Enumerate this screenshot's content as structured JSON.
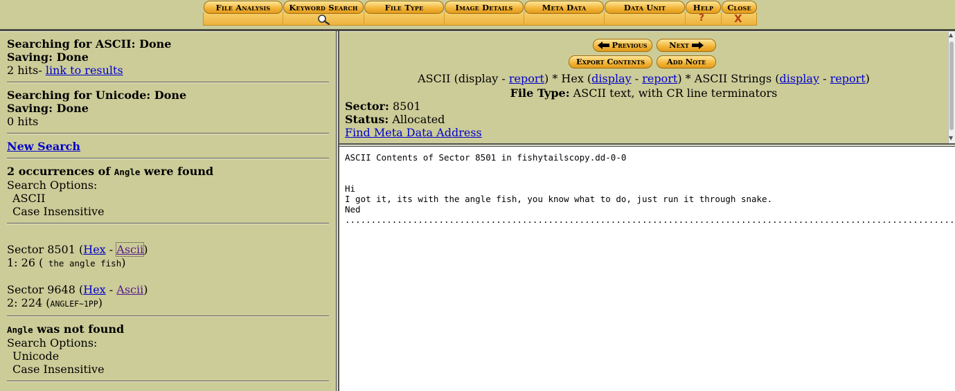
{
  "toolbar": {
    "file_analysis": "File Analysis",
    "keyword_search": "Keyword Search",
    "file_type": "File Type",
    "image_details": "Image Details",
    "meta_data": "Meta Data",
    "data_unit": "Data Unit",
    "help": "Help",
    "help_glyph": "?",
    "close": "Close",
    "close_glyph": "X"
  },
  "left": {
    "ascii_search": {
      "label": "Searching for ASCII",
      "status": ": Done"
    },
    "ascii_saving": {
      "label": "Saving",
      "status": ": Done"
    },
    "ascii_hits": "2 hits- ",
    "results_link": "link to results",
    "unicode_search": {
      "label": "Searching for Unicode",
      "status": ": Done"
    },
    "unicode_saving": {
      "label": "Saving",
      "status": ": Done"
    },
    "unicode_hits": "0 hits",
    "new_search": "New Search",
    "found": {
      "prefix": "2 occurrences of ",
      "keyword": "Angle",
      "suffix": " were found"
    },
    "found_options_label": "Search Options:",
    "found_options": [
      "ASCII",
      "Case Insensitive"
    ],
    "hits": [
      {
        "sector": "Sector 8501 (",
        "hex": "Hex",
        "sep": " - ",
        "ascii": "Ascii",
        "close": ")",
        "offset": "1: 26 (",
        "context": " the angle fish",
        "end": ")"
      },
      {
        "sector": "Sector 9648 (",
        "hex": "Hex",
        "sep": " - ",
        "ascii": "Ascii",
        "close": ")",
        "offset": "2: 224 (",
        "context": "ANGLEF~1PP",
        "end": ")"
      }
    ],
    "notfound": {
      "keyword": "Angle",
      "suffix": " was not found"
    },
    "notfound_options_label": "Search Options:",
    "notfound_options": [
      "Unicode",
      "Case Insensitive"
    ]
  },
  "viewer": {
    "previous": "Previous",
    "next": "Next",
    "export": "Export Contents",
    "add_note": "Add Note",
    "modes": {
      "ascii": "ASCII (display - ",
      "ascii_report": "report",
      "hex": ") * Hex (",
      "hex_display": "display",
      "dash1": " - ",
      "hex_report": "report",
      "strings": ") * ASCII Strings (",
      "strings_display": "display",
      "dash2": " - ",
      "strings_report": "report",
      "end": ")"
    },
    "file_type_label": "File Type:",
    "file_type_value": " ASCII text, with CR line terminators",
    "sector_label": "Sector:",
    "sector_value": " 8501",
    "status_label": "Status:",
    "status_value": " Allocated",
    "find_meta": "Find Meta Data Address"
  },
  "content": {
    "text": "ASCII Contents of Sector 8501 in fishytailscopy.dd-0-0\n\n\nHi\nI got it, its with the angle fish, you know what to do, just run it through snake.\nNed\n........................................................................................................................................................................"
  },
  "colors": {
    "background": "#cccc99",
    "button": "#f2b437",
    "link": "#0000cc",
    "visited_link": "#551a8b",
    "help_close_glyph": "#b43f12"
  },
  "icons": [
    "magnifier-icon",
    "arrow-left-icon",
    "arrow-right-icon"
  ]
}
